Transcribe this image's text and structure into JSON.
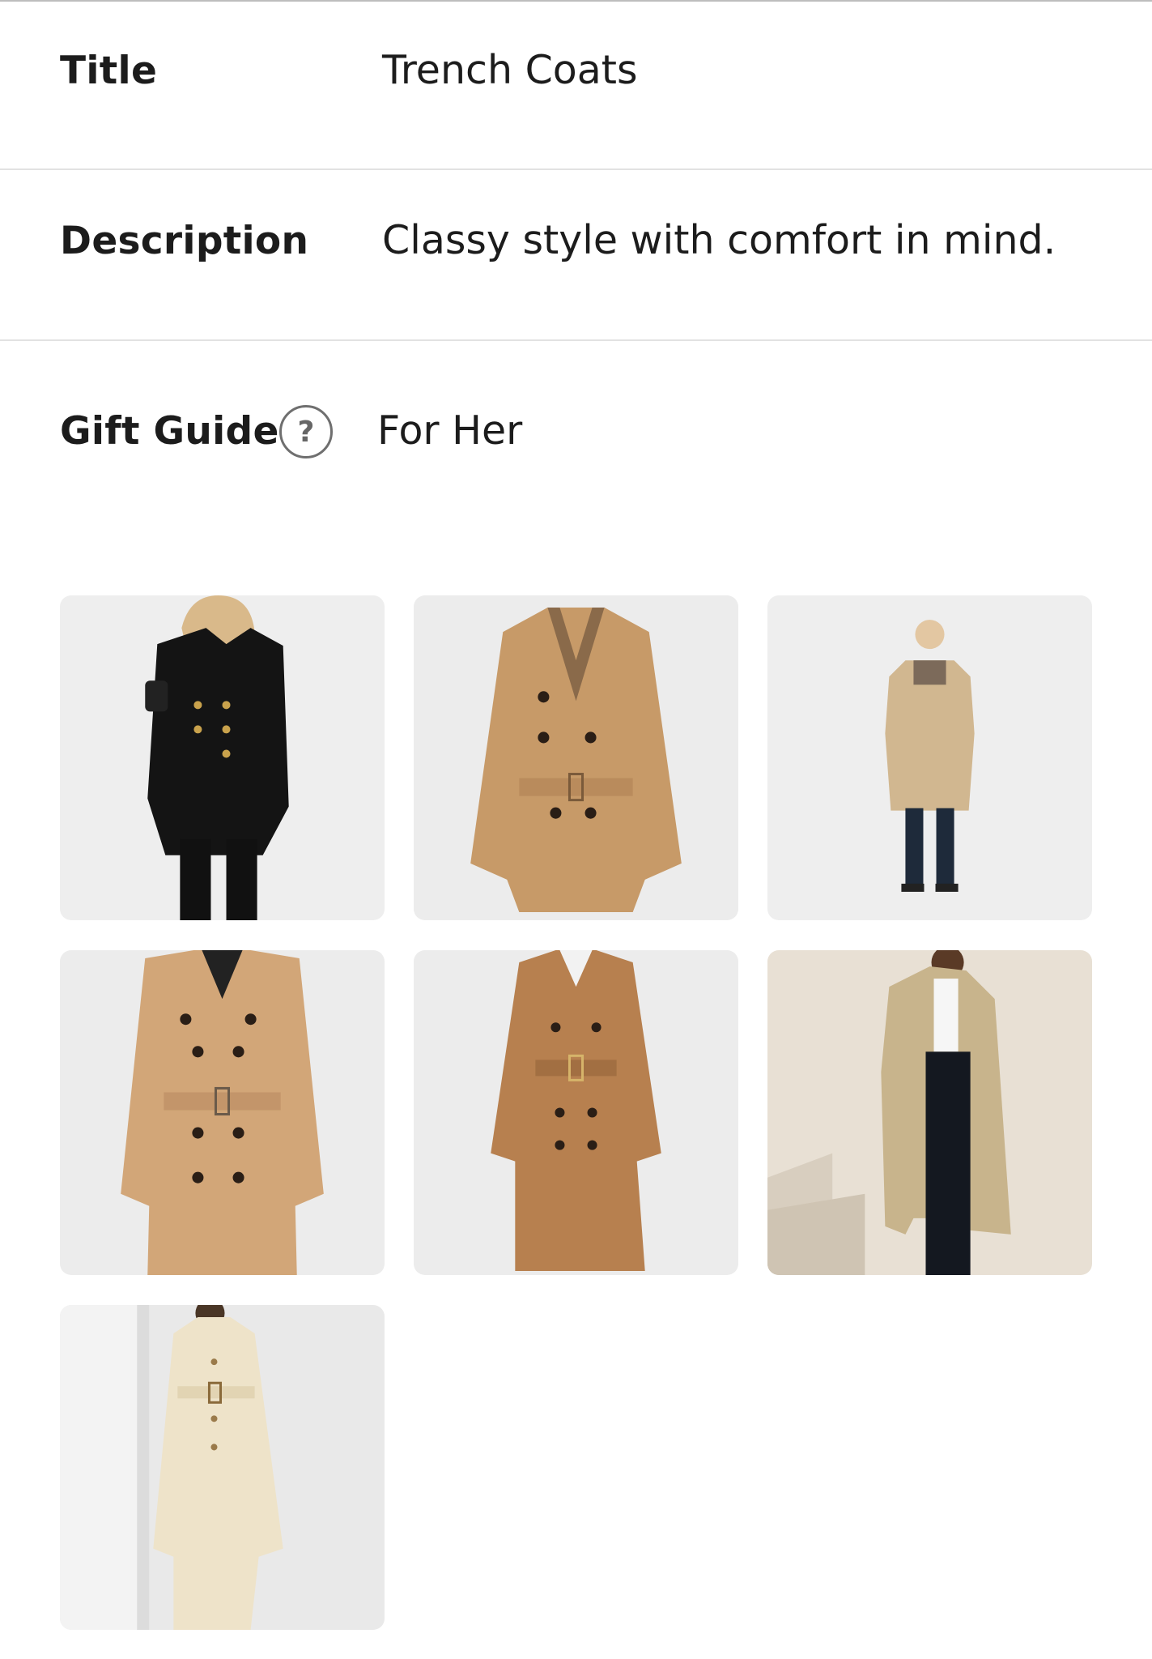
{
  "fields": {
    "title": {
      "label": "Title",
      "value": "Trench Coats"
    },
    "description": {
      "label": "Description",
      "value": "Classy style with comfort in mind."
    },
    "gift_guide": {
      "label": "Gift Guide",
      "help_icon": "?",
      "value": "For Her"
    }
  },
  "gallery": {
    "items": [
      {
        "icon": "black-trench-coat-model-image",
        "colors": {
          "bg": "#eeeeee",
          "coat": "#141414"
        }
      },
      {
        "icon": "camel-trench-coat-image",
        "colors": {
          "bg": "#ececec",
          "coat": "#c79a68"
        }
      },
      {
        "icon": "beige-trench-coat-model-image",
        "colors": {
          "bg": "#eeeeee",
          "coat": "#d1b790"
        }
      },
      {
        "icon": "tan-trench-coat-image",
        "colors": {
          "bg": "#ececec",
          "coat": "#d2a678"
        }
      },
      {
        "icon": "brown-trench-coat-image",
        "colors": {
          "bg": "#ececec",
          "coat": "#b7804f"
        }
      },
      {
        "icon": "khaki-trench-coat-model-image",
        "colors": {
          "bg": "#e8e0d4",
          "coat": "#c8b48c"
        }
      },
      {
        "icon": "cream-trench-coat-model-image",
        "colors": {
          "bg": "#e9e9e9",
          "coat": "#eee3c9"
        }
      }
    ]
  }
}
